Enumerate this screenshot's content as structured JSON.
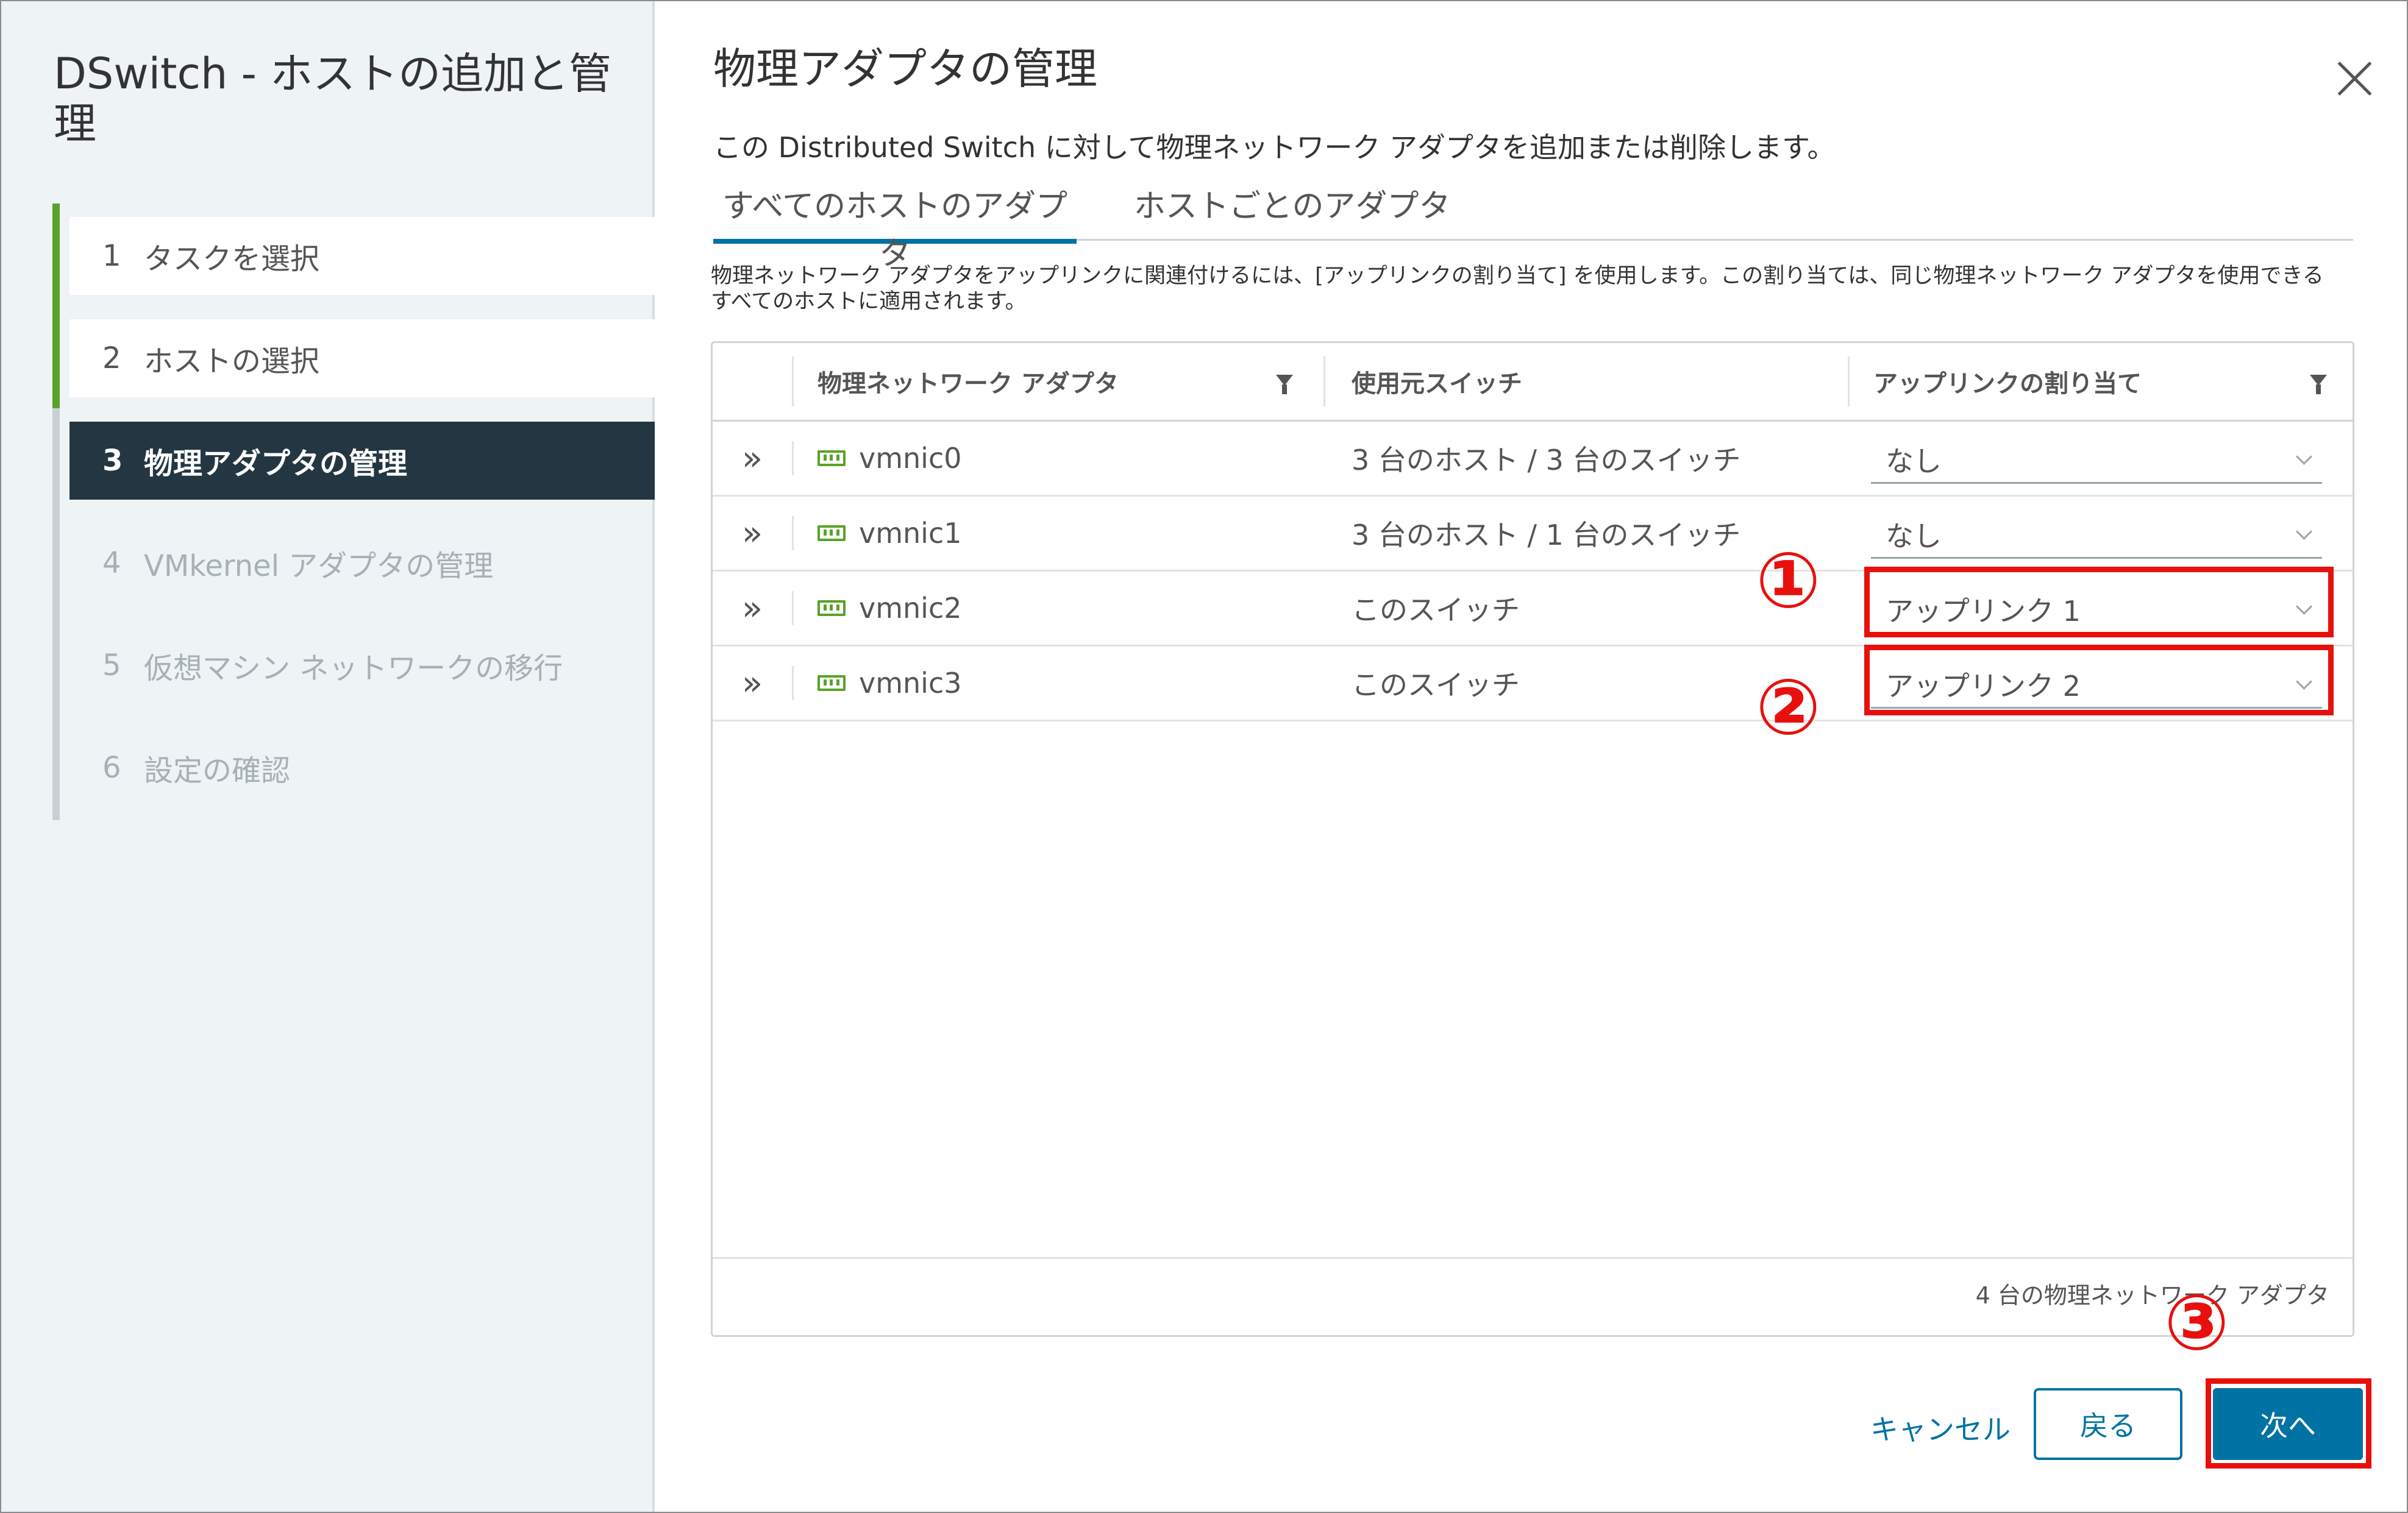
{
  "wizard": {
    "title": "DSwitch - ホストの追加と管理",
    "steps": [
      {
        "num": "1",
        "label": "タスクを選択"
      },
      {
        "num": "2",
        "label": "ホストの選択"
      },
      {
        "num": "3",
        "label": "物理アダプタの管理"
      },
      {
        "num": "4",
        "label": "VMkernel アダプタの管理"
      },
      {
        "num": "5",
        "label": "仮想マシン ネットワークの移行"
      },
      {
        "num": "6",
        "label": "設定の確認"
      }
    ],
    "active_step": 3
  },
  "main": {
    "title": "物理アダプタの管理",
    "description": "この Distributed Switch に対して物理ネットワーク アダプタを追加または削除します。",
    "tabs": [
      {
        "label": "すべてのホストのアダプタ",
        "active": true
      },
      {
        "label": "ホストごとのアダプタ",
        "active": false
      }
    ],
    "info": "物理ネットワーク アダプタをアップリンクに関連付けるには、[アップリンクの割り当て] を使用します。この割り当ては、同じ物理ネットワーク アダプタを使用できるすべてのホストに適用されます。"
  },
  "table": {
    "headers": {
      "adapter": "物理ネットワーク アダプタ",
      "switch": "使用元スイッチ",
      "uplink": "アップリンクの割り当て"
    },
    "rows": [
      {
        "adapter": "vmnic0",
        "switch": "3 台のホスト / 3 台のスイッチ",
        "uplink": "なし"
      },
      {
        "adapter": "vmnic1",
        "switch": "3 台のホスト / 1 台のスイッチ",
        "uplink": "なし"
      },
      {
        "adapter": "vmnic2",
        "switch": "このスイッチ",
        "uplink": "アップリンク 1"
      },
      {
        "adapter": "vmnic3",
        "switch": "このスイッチ",
        "uplink": "アップリンク 2"
      }
    ],
    "footer": "4 台の物理ネットワーク アダプタ"
  },
  "annotations": {
    "marker1": "①",
    "marker2": "②",
    "marker3": "③",
    "color": "#e8100d"
  },
  "buttons": {
    "cancel": "キャンセル",
    "back": "戻る",
    "next": "次へ"
  },
  "colors": {
    "accent": "#0072a3",
    "sidebar_active": "#233642",
    "step_done": "#5aa22a"
  }
}
